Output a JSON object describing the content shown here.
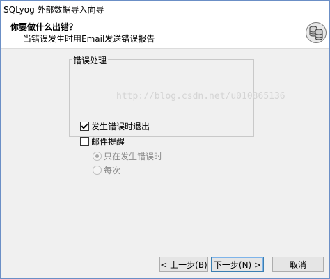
{
  "window": {
    "title": "SQLyog 外部数据导入向导"
  },
  "header": {
    "title": "你要做什么出错？",
    "subtitle": "当错误发生时用Email发送错误报告",
    "icon": "database-icon"
  },
  "error_group": {
    "label": "错误处理",
    "exit_on_error": {
      "label": "发生错误时退出",
      "checked": true
    },
    "email_alert": {
      "label": "邮件提醒",
      "checked": false
    },
    "radio_only_on_error": {
      "label": "只在发生错误时",
      "selected": true,
      "disabled": true
    },
    "radio_every_time": {
      "label": "每次",
      "selected": false,
      "disabled": true
    }
  },
  "watermark": "http://blog.csdn.net/u010865136",
  "buttons": {
    "back": "< 上一步(B)",
    "next": "下一步(N) >",
    "cancel": "取消"
  }
}
